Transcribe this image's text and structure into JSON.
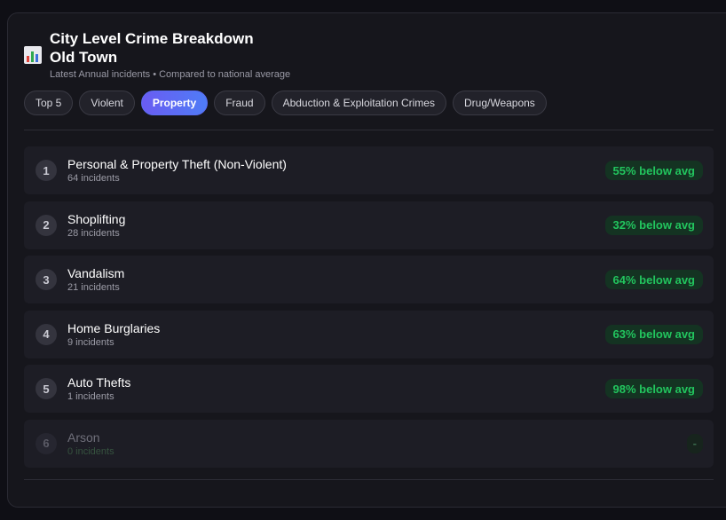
{
  "header": {
    "icon": "bar-chart-icon",
    "title_line1": "City Level Crime Breakdown",
    "title_line2": "Old Town",
    "subtitle": "Latest Annual incidents • Compared to national average"
  },
  "tabs": [
    {
      "label": "Top 5",
      "active": false
    },
    {
      "label": "Violent",
      "active": false
    },
    {
      "label": "Property",
      "active": true
    },
    {
      "label": "Fraud",
      "active": false
    },
    {
      "label": "Abduction & Exploitation Crimes",
      "active": false
    },
    {
      "label": "Drug/Weapons",
      "active": false
    }
  ],
  "colors": {
    "accent_gradient_start": "#6a5cf2",
    "accent_gradient_end": "#4f7cf6",
    "below_avg_green": "#22c55e"
  },
  "items": [
    {
      "rank": "1",
      "name": "Personal & Property Theft (Non-Violent)",
      "count": "64 incidents",
      "badge": "55% below avg"
    },
    {
      "rank": "2",
      "name": "Shoplifting",
      "count": "28 incidents",
      "badge": "32% below avg"
    },
    {
      "rank": "3",
      "name": "Vandalism",
      "count": "21 incidents",
      "badge": "64% below avg"
    },
    {
      "rank": "4",
      "name": "Home Burglaries",
      "count": "9 incidents",
      "badge": "63% below avg"
    },
    {
      "rank": "5",
      "name": "Auto Thefts",
      "count": "1 incidents",
      "badge": "98% below avg"
    },
    {
      "rank": "6",
      "name": "Arson",
      "count": "0 incidents",
      "badge": "-"
    }
  ]
}
